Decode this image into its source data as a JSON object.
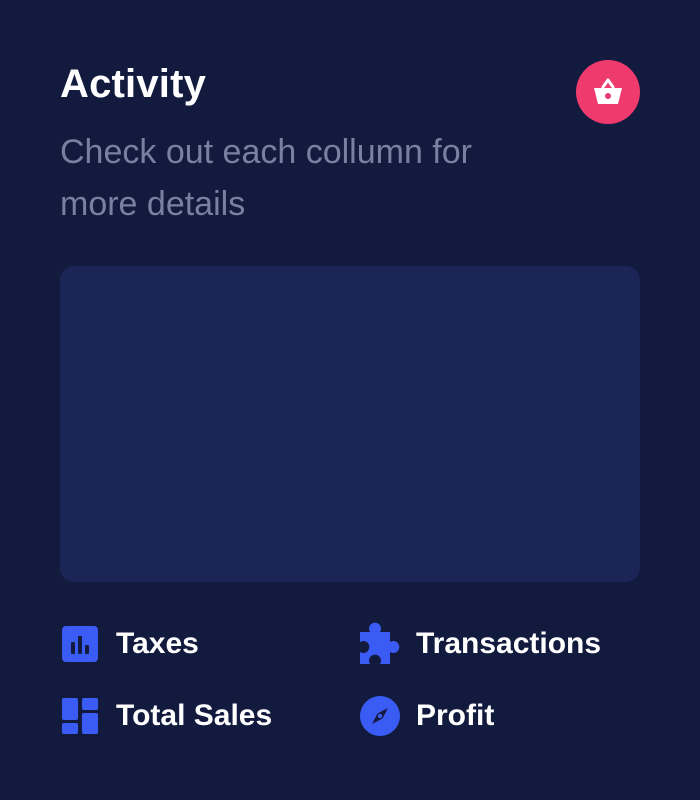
{
  "card": {
    "title": "Activity",
    "subtitle": "Check out each collumn for more details",
    "action_icon": "basket-icon"
  },
  "legend": {
    "items": [
      {
        "label": "Taxes",
        "icon": "bar-chart-icon"
      },
      {
        "label": "Transactions",
        "icon": "puzzle-icon"
      },
      {
        "label": "Total Sales",
        "icon": "dashboard-layout-icon"
      },
      {
        "label": "Profit",
        "icon": "compass-icon"
      }
    ]
  },
  "colors": {
    "background": "#121a3e",
    "panel": "#1b2656",
    "accent": "#ef3a6e",
    "icon_blue": "#3a5cf5",
    "subtitle": "#7a809f"
  }
}
